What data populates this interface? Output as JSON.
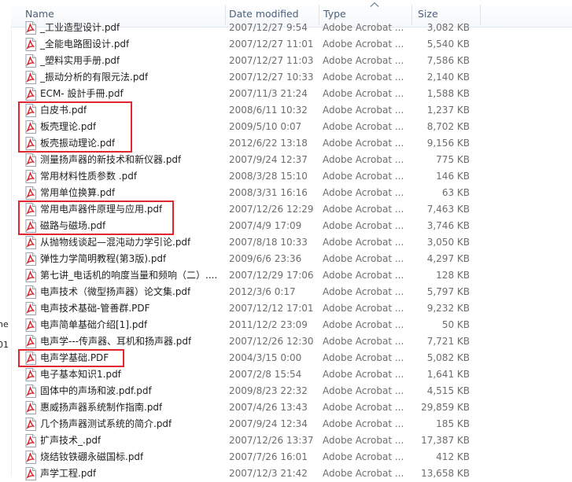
{
  "columns": {
    "name": "Name",
    "date_modified": "Date modified",
    "type": "Type",
    "size": "Size"
  },
  "left_fragments": [
    "he",
    "01"
  ],
  "files": [
    {
      "name": "_工业造型设计.pdf",
      "date": "2007/12/27 9:54",
      "type": "Adobe Acrobat ...",
      "size": "3,082 KB",
      "highlighted": false
    },
    {
      "name": "_全能电路图设计.pdf",
      "date": "2007/12/27 11:01",
      "type": "Adobe Acrobat ...",
      "size": "5,540 KB",
      "highlighted": false
    },
    {
      "name": "_塑料实用手册.pdf",
      "date": "2007/12/27 11:03",
      "type": "Adobe Acrobat ...",
      "size": "7,586 KB",
      "highlighted": false
    },
    {
      "name": "_振动分析的有限元法.pdf",
      "date": "2007/12/27 10:33",
      "type": "Adobe Acrobat ...",
      "size": "2,140 KB",
      "highlighted": false
    },
    {
      "name": "ECM- 設計手冊.pdf",
      "date": "2007/11/3 21:24",
      "type": "Adobe Acrobat ...",
      "size": "1,588 KB",
      "highlighted": false
    },
    {
      "name": "白皮书.pdf",
      "date": "2008/6/11 10:32",
      "type": "Adobe Acrobat ...",
      "size": "1,237 KB",
      "highlighted": true
    },
    {
      "name": "板壳理论.pdf",
      "date": "2009/5/10 0:07",
      "type": "Adobe Acrobat ...",
      "size": "8,702 KB",
      "highlighted": true
    },
    {
      "name": "板壳振动理论.pdf",
      "date": "2012/6/22 13:18",
      "type": "Adobe Acrobat ...",
      "size": "9,156 KB",
      "highlighted": true
    },
    {
      "name": "测量扬声器的新技术和新仪器.pdf",
      "date": "2007/9/24 12:37",
      "type": "Adobe Acrobat ...",
      "size": "775 KB",
      "highlighted": false
    },
    {
      "name": "常用材料性质参数 .pdf",
      "date": "2008/3/28 15:10",
      "type": "Adobe Acrobat ...",
      "size": "146 KB",
      "highlighted": false
    },
    {
      "name": "常用单位换算.pdf",
      "date": "2008/3/31 16:16",
      "type": "Adobe Acrobat ...",
      "size": "63 KB",
      "highlighted": false
    },
    {
      "name": "常用电声器件原理与应用.pdf",
      "date": "2007/12/26 12:29",
      "type": "Adobe Acrobat ...",
      "size": "7,463 KB",
      "highlighted": true
    },
    {
      "name": "磁路与磁场.pdf",
      "date": "2007/4/9 17:09",
      "type": "Adobe Acrobat ...",
      "size": "3,746 KB",
      "highlighted": true
    },
    {
      "name": "从抛物线谈起—混沌动力学引论.pdf",
      "date": "2007/8/18 10:33",
      "type": "Adobe Acrobat ...",
      "size": "3,050 KB",
      "highlighted": false
    },
    {
      "name": "弹性力学简明教程(第3版).pdf",
      "date": "2009/6/6 23:36",
      "type": "Adobe Acrobat ...",
      "size": "4,297 KB",
      "highlighted": false
    },
    {
      "name": "第七讲_电话机的响度当量和频响（二）....",
      "date": "2007/12/29 17:06",
      "type": "Adobe Acrobat ...",
      "size": "128 KB",
      "highlighted": false
    },
    {
      "name": "电声技术（微型扬声器）论文集.pdf",
      "date": "2012/3/6 0:17",
      "type": "Adobe Acrobat ...",
      "size": "5,797 KB",
      "highlighted": false
    },
    {
      "name": "电声技术基础-管善群.PDF",
      "date": "2007/12/12 17:01",
      "type": "Adobe Acrobat ...",
      "size": "9,232 KB",
      "highlighted": false
    },
    {
      "name": "电声简单基础介绍[1].pdf",
      "date": "2011/12/2 23:09",
      "type": "Adobe Acrobat ...",
      "size": "50 KB",
      "highlighted": false
    },
    {
      "name": "电声学---传声器、耳机和扬声器.pdf",
      "date": "2007/12/26 12:30",
      "type": "Adobe Acrobat ...",
      "size": "7,721 KB",
      "highlighted": false
    },
    {
      "name": "电声学基础.PDF",
      "date": "2004/3/15 0:00",
      "type": "Adobe Acrobat ...",
      "size": "5,082 KB",
      "highlighted": true
    },
    {
      "name": "电子基本知识1.pdf",
      "date": "2007/2/8 15:54",
      "type": "Adobe Acrobat ...",
      "size": "1,641 KB",
      "highlighted": false
    },
    {
      "name": "固体中的声场和波.pdf.pdf",
      "date": "2009/8/23 22:32",
      "type": "Adobe Acrobat ...",
      "size": "4,515 KB",
      "highlighted": false
    },
    {
      "name": "惠威扬声器系统制作指南.pdf",
      "date": "2007/4/26 13:43",
      "type": "Adobe Acrobat ...",
      "size": "29,859 KB",
      "highlighted": false
    },
    {
      "name": "几个扬声器测试系统的简介.pdf",
      "date": "2007/9/24 12:34",
      "type": "Adobe Acrobat ...",
      "size": "185 KB",
      "highlighted": false
    },
    {
      "name": "扩声技术_.pdf",
      "date": "2007/12/26 13:37",
      "type": "Adobe Acrobat ...",
      "size": "17,387 KB",
      "highlighted": false
    },
    {
      "name": "烧结钕铁硼永磁国标.pdf",
      "date": "2007/7/26 16:01",
      "type": "Adobe Acrobat ...",
      "size": "412 KB",
      "highlighted": false
    },
    {
      "name": "声学工程.pdf",
      "date": "2007/12/3 21:42",
      "type": "Adobe Acrobat ...",
      "size": "13,658 KB",
      "highlighted": false
    }
  ],
  "colors": {
    "highlight_border": "#e1262e",
    "pdf_icon_red": "#d8232a",
    "header_text": "#4c607a",
    "meta_text": "#6d6d6d"
  },
  "icons": {
    "file": "pdf-file-icon",
    "sort": "sort-up-arrow-icon"
  }
}
